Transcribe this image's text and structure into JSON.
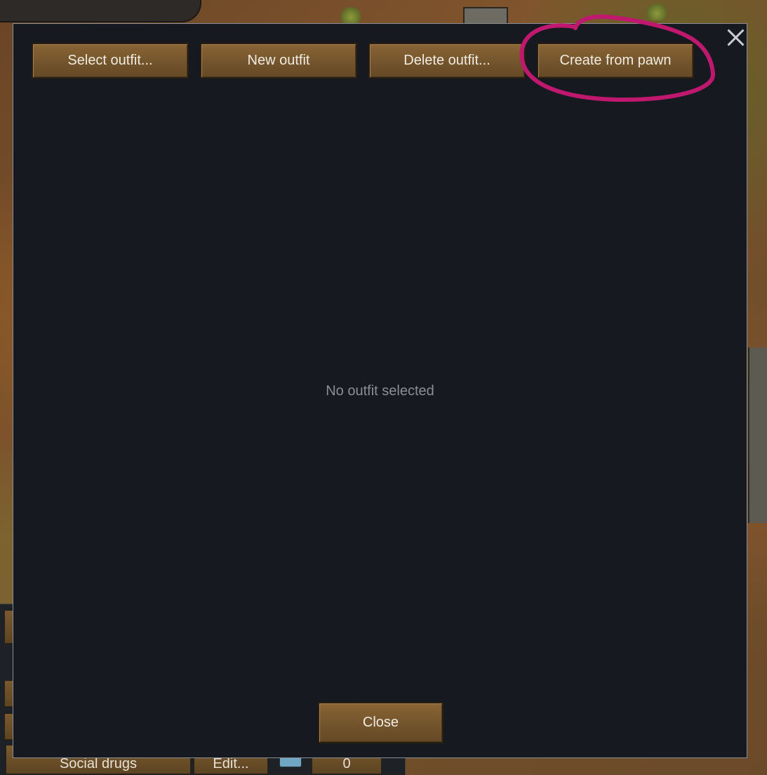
{
  "dialog": {
    "toolbar": {
      "buttons": [
        {
          "label": "Select outfit..."
        },
        {
          "label": "New outfit"
        },
        {
          "label": "Delete outfit..."
        },
        {
          "label": "Create from pawn"
        }
      ]
    },
    "empty_message": "No outfit selected",
    "close_label": "Close"
  },
  "background_panel": {
    "row_label": "Social drugs",
    "edit_label": "Edit...",
    "count": "0"
  },
  "colors": {
    "dialog_bg": "#161a20",
    "button_bg": "#73542c",
    "annotation": "#c0186e"
  },
  "icons": [
    "close-icon",
    "annotation-circle"
  ]
}
